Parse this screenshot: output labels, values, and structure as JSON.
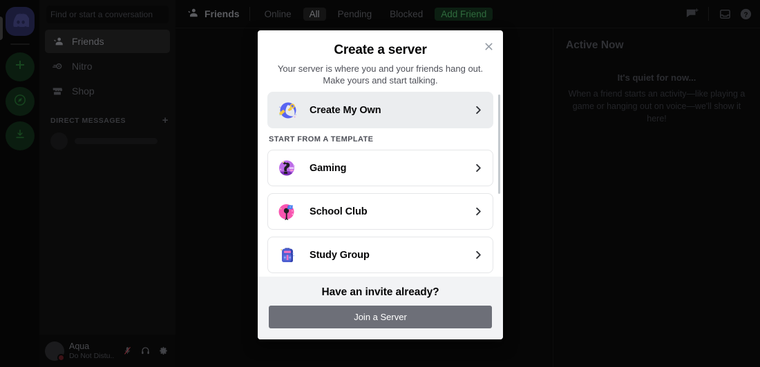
{
  "app": {
    "server_rail": [
      {
        "name": "discord-home",
        "icon": "discord-logo-icon"
      },
      {
        "name": "add-server",
        "icon": "plus-icon"
      },
      {
        "name": "explore-servers",
        "icon": "compass-icon"
      },
      {
        "name": "download-apps",
        "icon": "download-icon"
      }
    ],
    "sidebar": {
      "search_placeholder": "Find or start a conversation",
      "items": [
        {
          "label": "Friends",
          "icon": "friends-icon",
          "active": true
        },
        {
          "label": "Nitro",
          "icon": "nitro-icon",
          "active": false
        },
        {
          "label": "Shop",
          "icon": "shop-icon",
          "active": false
        }
      ],
      "dm_header": "DIRECT MESSAGES",
      "dm_add_label": "+"
    },
    "user_panel": {
      "name": "Aqua",
      "status": "Do Not Distu...",
      "icons": [
        "microphone-muted-icon",
        "headphones-icon",
        "gear-icon"
      ]
    },
    "topbar": {
      "title": "Friends",
      "tabs": [
        {
          "label": "Online",
          "selected": false,
          "cta": false
        },
        {
          "label": "All",
          "selected": true,
          "cta": false
        },
        {
          "label": "Pending",
          "selected": false,
          "cta": false
        },
        {
          "label": "Blocked",
          "selected": false,
          "cta": false
        },
        {
          "label": "Add Friend",
          "selected": false,
          "cta": true
        }
      ],
      "right_icons": [
        "new-group-dm-icon",
        "inbox-icon",
        "help-icon"
      ]
    },
    "active_now": {
      "title": "Active Now",
      "empty_title": "It's quiet for now...",
      "empty_body": "When a friend starts an activity—like playing a game or hanging out on voice—we'll show it here!"
    }
  },
  "modal": {
    "title": "Create a server",
    "subtitle": "Your server is where you and your friends hang out. Make yours and start talking.",
    "close_label": "✕",
    "primary_option": {
      "label": "Create My Own",
      "icon": "create-my-own-icon"
    },
    "section_label": "START FROM A TEMPLATE",
    "templates": [
      {
        "label": "Gaming",
        "icon": "gaming-template-icon"
      },
      {
        "label": "School Club",
        "icon": "school-club-template-icon"
      },
      {
        "label": "Study Group",
        "icon": "study-group-template-icon"
      }
    ],
    "footer": {
      "title": "Have an invite already?",
      "join_label": "Join a Server"
    }
  },
  "colors": {
    "modal_bg": "#ffffff",
    "footer_bg": "#f2f3f5",
    "join_button": "#6d6f78",
    "primary_row": "#ebedef",
    "text_primary": "#060607",
    "text_secondary": "#4e5058"
  }
}
